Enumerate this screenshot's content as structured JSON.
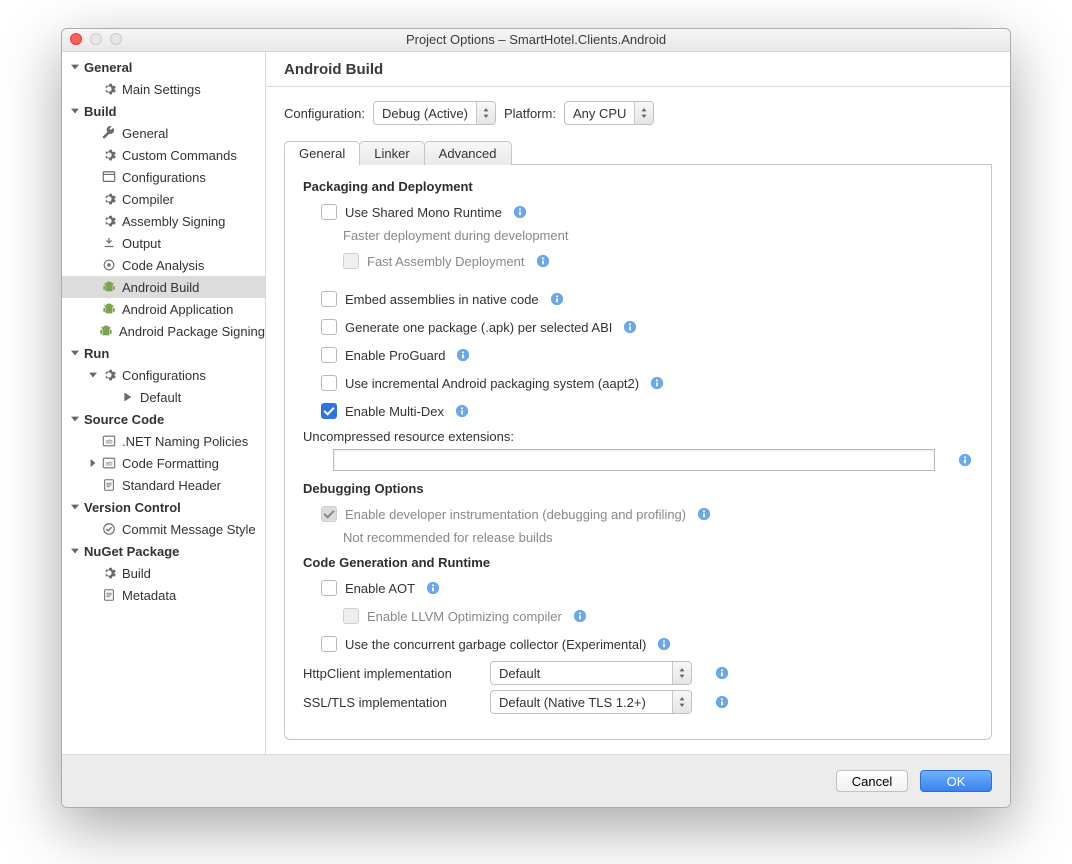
{
  "window": {
    "title": "Project Options – SmartHotel.Clients.Android"
  },
  "sidebar": {
    "sections": [
      {
        "label": "General",
        "items": [
          {
            "label": "Main Settings",
            "icon": "gear"
          }
        ]
      },
      {
        "label": "Build",
        "items": [
          {
            "label": "General",
            "icon": "wrench"
          },
          {
            "label": "Custom Commands",
            "icon": "gear"
          },
          {
            "label": "Configurations",
            "icon": "window"
          },
          {
            "label": "Compiler",
            "icon": "gear"
          },
          {
            "label": "Assembly Signing",
            "icon": "gear"
          },
          {
            "label": "Output",
            "icon": "output"
          },
          {
            "label": "Code Analysis",
            "icon": "target"
          },
          {
            "label": "Android Build",
            "icon": "android",
            "selected": true
          },
          {
            "label": "Android Application",
            "icon": "android"
          },
          {
            "label": "Android Package Signing",
            "icon": "android"
          }
        ]
      },
      {
        "label": "Run",
        "items": [
          {
            "label": "Configurations",
            "icon": "gear",
            "expandable": true,
            "children": [
              {
                "label": "Default",
                "icon": "play"
              }
            ]
          }
        ]
      },
      {
        "label": "Source Code",
        "items": [
          {
            "label": ".NET Naming Policies",
            "icon": "code"
          },
          {
            "label": "Code Formatting",
            "icon": "code",
            "expandable": true,
            "collapsed": true
          },
          {
            "label": "Standard Header",
            "icon": "doc"
          }
        ]
      },
      {
        "label": "Version Control",
        "items": [
          {
            "label": "Commit Message Style",
            "icon": "check"
          }
        ]
      },
      {
        "label": "NuGet Package",
        "items": [
          {
            "label": "Build",
            "icon": "gear"
          },
          {
            "label": "Metadata",
            "icon": "doc"
          }
        ]
      }
    ]
  },
  "main": {
    "heading": "Android Build",
    "config_label": "Configuration:",
    "config_value": "Debug (Active)",
    "platform_label": "Platform:",
    "platform_value": "Any CPU",
    "tabs": [
      {
        "label": "General",
        "active": true
      },
      {
        "label": "Linker"
      },
      {
        "label": "Advanced"
      }
    ],
    "packaging_title": "Packaging and Deployment",
    "chk_shared_mono": "Use Shared Mono Runtime",
    "hint_shared_mono": "Faster deployment during development",
    "chk_fast_assembly": "Fast Assembly Deployment",
    "chk_embed": "Embed assemblies in native code",
    "chk_one_apk": "Generate one package (.apk) per selected ABI",
    "chk_proguard": "Enable ProGuard",
    "chk_aapt2": "Use incremental Android packaging system (aapt2)",
    "chk_multidex": "Enable Multi-Dex",
    "uncompressed_label": "Uncompressed resource extensions:",
    "uncompressed_value": "",
    "debugging_title": "Debugging Options",
    "chk_dev_instr": "Enable developer instrumentation (debugging and profiling)",
    "hint_dev_instr": "Not recommended for release builds",
    "codegen_title": "Code Generation and Runtime",
    "chk_aot": "Enable AOT",
    "chk_llvm": "Enable LLVM Optimizing compiler",
    "chk_concurrent_gc": "Use the concurrent garbage collector (Experimental)",
    "httpclient_label": "HttpClient implementation",
    "httpclient_value": "Default",
    "ssltls_label": "SSL/TLS implementation",
    "ssltls_value": "Default (Native TLS 1.2+)"
  },
  "footer": {
    "cancel": "Cancel",
    "ok": "OK"
  }
}
